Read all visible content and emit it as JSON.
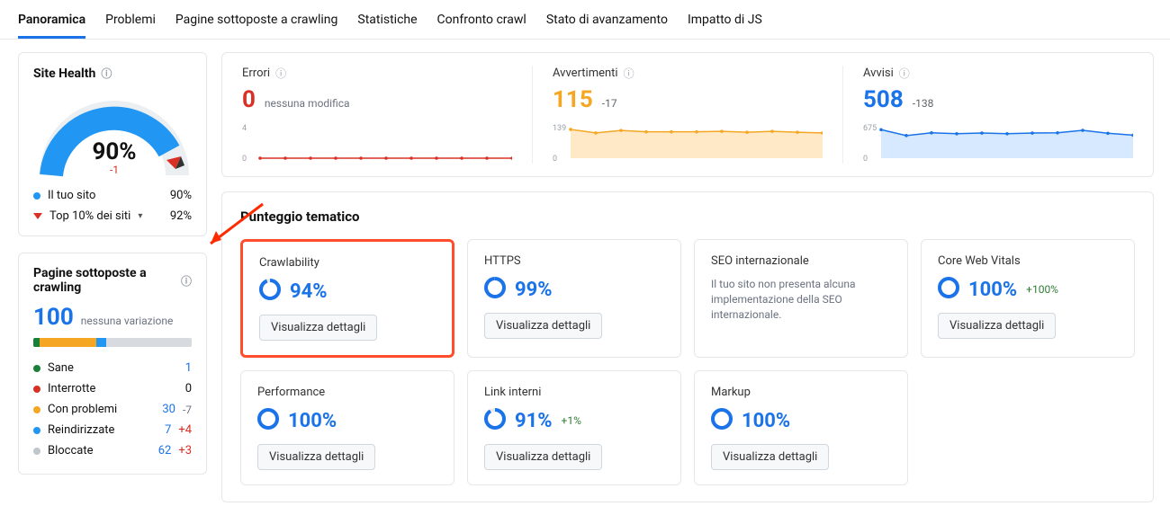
{
  "tabs": [
    "Panoramica",
    "Problemi",
    "Pagine sottoposte a crawling",
    "Statistiche",
    "Confronto crawl",
    "Stato di avanzamento",
    "Impatto di JS"
  ],
  "active_tab": 0,
  "site_health": {
    "title": "Site Health",
    "value": "90%",
    "delta": "-1",
    "legend": [
      {
        "color": "#2196f3",
        "label": "Il tuo sito",
        "value": "90%"
      },
      {
        "color": "#d93025",
        "label": "Top 10% dei siti",
        "value": "92%",
        "caret": true
      }
    ]
  },
  "pages": {
    "title": "Pagine sottoposte a crawling",
    "count": "100",
    "sub": "nessuna variazione",
    "bar": [
      {
        "color": "#188038",
        "w": 4
      },
      {
        "color": "#f5a623",
        "w": 36
      },
      {
        "color": "#2196f3",
        "w": 6
      },
      {
        "color": "#d7dbdf",
        "w": 54
      }
    ],
    "rows": [
      {
        "dot": "#188038",
        "label": "Sane",
        "v1": "1",
        "c1": "val-blue"
      },
      {
        "dot": "#d93025",
        "label": "Interrotte",
        "v1": "0"
      },
      {
        "dot": "#f5a623",
        "label": "Con problemi",
        "v1": "30",
        "c1": "val-blue",
        "v2": "-7"
      },
      {
        "dot": "#2196f3",
        "label": "Reindirizzate",
        "v1": "7",
        "c1": "val-blue",
        "v2": "+4",
        "c2": "val-red"
      },
      {
        "dot": "#bfc6cc",
        "label": "Bloccate",
        "v1": "62",
        "c1": "val-blue",
        "v2": "+3",
        "c2": "val-red"
      }
    ]
  },
  "top": [
    {
      "label": "Errori",
      "value": "0",
      "color": "#d93025",
      "delta": "",
      "sub": "nessuna modifica"
    },
    {
      "label": "Avvertimenti",
      "value": "115",
      "color": "#f5a623",
      "delta": "-17"
    },
    {
      "label": "Avvisi",
      "value": "508",
      "color": "#1a73e8",
      "delta": "-138"
    }
  ],
  "chart_data": [
    {
      "type": "line",
      "title": "Errori",
      "ylim": [
        0,
        4
      ],
      "yticks": [
        0,
        4
      ],
      "values": [
        0,
        0,
        0,
        0,
        0,
        0,
        0,
        0,
        0,
        0,
        0
      ],
      "color": "#d93025",
      "fill": "none"
    },
    {
      "type": "area",
      "title": "Avvertimenti",
      "ylim": [
        0,
        139
      ],
      "yticks": [
        0,
        139
      ],
      "values": [
        131,
        115,
        126,
        120,
        120,
        120,
        122,
        118,
        122,
        118,
        115
      ],
      "color": "#f5a623",
      "fill": "#ffe9c7"
    },
    {
      "type": "area",
      "title": "Avvisi",
      "ylim": [
        0,
        675
      ],
      "yticks": [
        0,
        675
      ],
      "values": [
        630,
        500,
        560,
        540,
        555,
        540,
        555,
        560,
        615,
        550,
        508
      ],
      "color": "#1a73e8",
      "fill": "#d6e9ff"
    }
  ],
  "thematic": {
    "title": "Punteggio tematico",
    "view_label": "Visualizza dettagli",
    "tiles": [
      {
        "title": "Crawlability",
        "pct": "94%",
        "highlight": true,
        "ring": 94
      },
      {
        "title": "HTTPS",
        "pct": "99%",
        "ring": 99
      },
      {
        "title": "SEO internazionale",
        "note": "Il tuo sito non presenta alcuna implementazione della SEO internazionale."
      },
      {
        "title": "Core Web Vitals",
        "pct": "100%",
        "ring": 100,
        "delta": "+100%"
      },
      {
        "title": "Performance",
        "pct": "100%",
        "ring": 100
      },
      {
        "title": "Link interni",
        "pct": "91%",
        "ring": 91,
        "delta": "+1%"
      },
      {
        "title": "Markup",
        "pct": "100%",
        "ring": 100
      }
    ]
  }
}
